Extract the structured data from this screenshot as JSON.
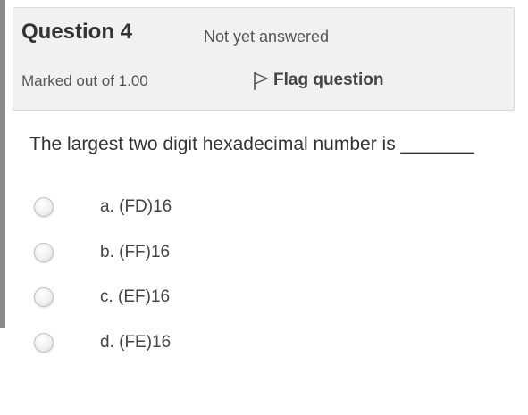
{
  "question": {
    "number_label": "Question 4",
    "state": "Not yet answered",
    "grade": "Marked out of 1.00",
    "flag_label": "Flag question",
    "text": "The largest two digit hexadecimal number is _______"
  },
  "answers": [
    {
      "label": "a. (FD)16"
    },
    {
      "label": "b. (FF)16"
    },
    {
      "label": "c. (EF)16"
    },
    {
      "label": "d. (FE)16"
    }
  ],
  "icons": {
    "flag": "flag-outline-icon",
    "radio": "radio-unselected"
  }
}
